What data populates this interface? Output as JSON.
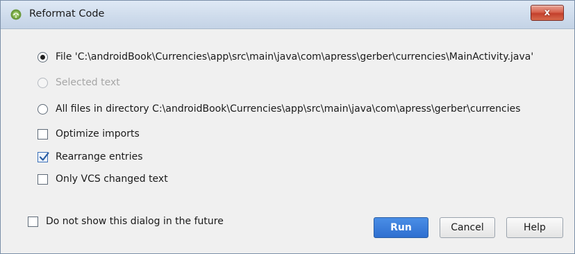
{
  "window": {
    "title": "Reformat Code",
    "close_symbol": "x"
  },
  "scope": {
    "file_option": "File 'C:\\androidBook\\Currencies\\app\\src\\main\\java\\com\\apress\\gerber\\currencies\\MainActivity.java'",
    "selected_text_option": "Selected text",
    "directory_option": "All files in directory C:\\androidBook\\Currencies\\app\\src\\main\\java\\com\\apress\\gerber\\currencies",
    "selected": "file",
    "selected_text_enabled": false
  },
  "options": {
    "optimize_imports": {
      "label": "Optimize imports",
      "checked": false
    },
    "rearrange_entries": {
      "label": "Rearrange entries",
      "checked": true
    },
    "only_vcs_changed": {
      "label": "Only VCS changed text",
      "checked": false
    }
  },
  "footer": {
    "do_not_show": {
      "label": "Do not show this dialog in the future",
      "checked": false
    }
  },
  "buttons": {
    "run": "Run",
    "cancel": "Cancel",
    "help": "Help"
  },
  "colors": {
    "titlebar": "#cfdcec",
    "accent": "#2f6fd0",
    "close_red": "#c3402c",
    "disabled_text": "#a6a6a6"
  }
}
